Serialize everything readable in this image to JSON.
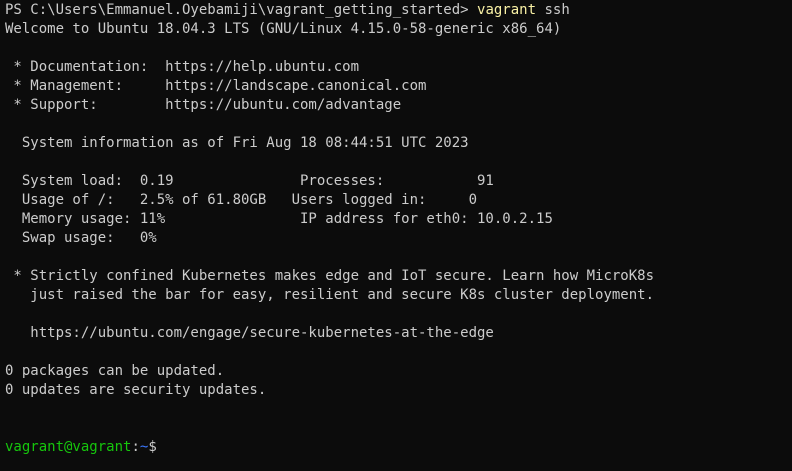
{
  "colors": {
    "background": "#0c0c0c",
    "foreground": "#cccccc",
    "command": "#f9f1a5",
    "user_host": "#16c60c",
    "path": "#3b78ff"
  },
  "prompt_line": {
    "ps_prefix": "PS C:\\Users\\Emmanuel.Oyebamiji\\vagrant_getting_started> ",
    "command": "vagrant",
    "args": " ssh"
  },
  "welcome": "Welcome to Ubuntu 18.04.3 LTS (GNU/Linux 4.15.0-58-generic x86_64)",
  "links": [
    " * Documentation:  https://help.ubuntu.com",
    " * Management:     https://landscape.canonical.com",
    " * Support:        https://ubuntu.com/advantage"
  ],
  "sysinfo_header": "  System information as of Fri Aug 18 08:44:51 UTC 2023",
  "sysinfo_rows": [
    "  System load:  0.19               Processes:           91",
    "  Usage of /:   2.5% of 61.80GB   Users logged in:     0",
    "  Memory usage: 11%                IP address for eth0: 10.0.2.15",
    "  Swap usage:   0%"
  ],
  "notice": [
    " * Strictly confined Kubernetes makes edge and IoT secure. Learn how MicroK8s",
    "   just raised the bar for easy, resilient and secure K8s cluster deployment.",
    "",
    "   https://ubuntu.com/engage/secure-kubernetes-at-the-edge"
  ],
  "updates": [
    "0 packages can be updated.",
    "0 updates are security updates."
  ],
  "shell_prompt": {
    "user_host": "vagrant@vagrant",
    "colon": ":",
    "path": "~",
    "symbol": "$"
  }
}
